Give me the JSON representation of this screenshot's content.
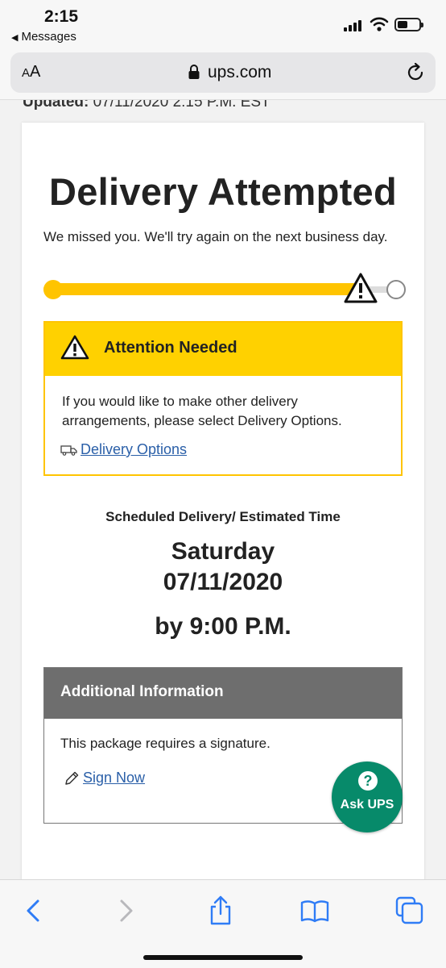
{
  "status_bar": {
    "time": "2:15",
    "back_app": "Messages"
  },
  "address_bar": {
    "aa_small": "A",
    "aa_large": "A",
    "url": "ups.com"
  },
  "page": {
    "updated_label": "Updated:",
    "updated_value": "07/11/2020 2:15 P.M. EST"
  },
  "tracking": {
    "title": "Delivery Attempted",
    "subtitle": "We missed you. We'll try again on the next business day.",
    "progress_fraction": 0.88
  },
  "attention": {
    "heading": "Attention Needed",
    "body": "If you would like to make other delivery arrangements, please select Delivery Options.",
    "link": "Delivery Options"
  },
  "schedule": {
    "label": "Scheduled Delivery/ Estimated Time",
    "day": "Saturday",
    "date": "07/11/2020",
    "time": "by 9:00 P.M."
  },
  "additional": {
    "heading": "Additional Information",
    "body": "This package requires a signature.",
    "link": "Sign Now"
  },
  "ask_ups": {
    "icon": "?",
    "label": "Ask UPS"
  },
  "colors": {
    "ups_yellow": "#ffd100",
    "link_blue": "#2a5fa8",
    "ask_green": "#078a6a"
  }
}
